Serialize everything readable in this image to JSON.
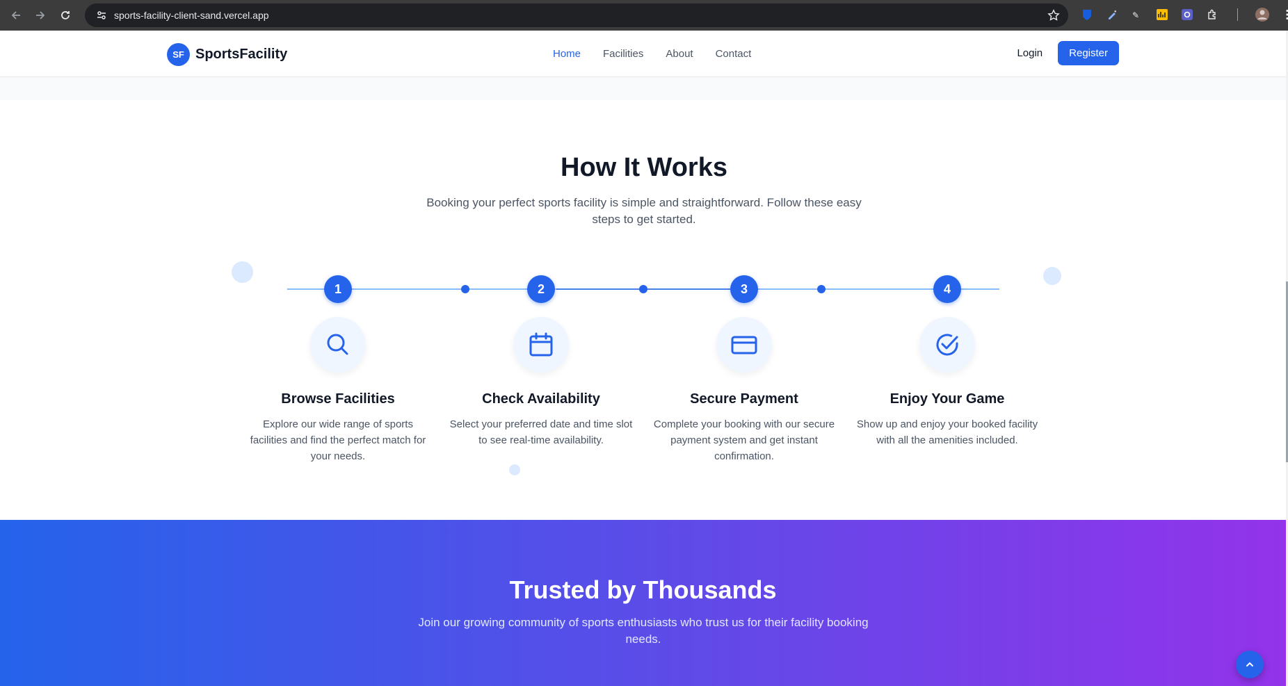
{
  "browser": {
    "url": "sports-facility-client-sand.vercel.app",
    "icons": [
      "back-icon",
      "forward-icon",
      "reload-icon",
      "site-info-icon",
      "bookmark-star-icon",
      "extensions-icon",
      "profile-icon",
      "menu-icon"
    ]
  },
  "header": {
    "logo_text": "SF",
    "brand": "SportsFacility",
    "nav": [
      "Home",
      "Facilities",
      "About",
      "Contact"
    ],
    "active_nav": "Home",
    "login": "Login",
    "register": "Register"
  },
  "how_it_works": {
    "title": "How It Works",
    "subtitle": "Booking your perfect sports facility is simple and straightforward. Follow these easy steps to get started.",
    "steps": [
      {
        "number": "1",
        "title": "Browse Facilities",
        "description": "Explore our wide range of sports facilities and find the perfect match for your needs.",
        "icon": "search-icon"
      },
      {
        "number": "2",
        "title": "Check Availability",
        "description": "Select your preferred date and time slot to see real-time availability.",
        "icon": "calendar-icon"
      },
      {
        "number": "3",
        "title": "Secure Payment",
        "description": "Complete your booking with our secure payment system and get instant confirmation.",
        "icon": "credit-card-icon"
      },
      {
        "number": "4",
        "title": "Enjoy Your Game",
        "description": "Show up and enjoy your booked facility with all the amenities included.",
        "icon": "check-circle-icon"
      }
    ]
  },
  "trusted": {
    "title": "Trusted by Thousands",
    "subtitle": "Join our growing community of sports enthusiasts who trust us for their facility booking needs."
  },
  "colors": {
    "accent": "#2563eb",
    "gradient_start": "#2563eb",
    "gradient_end": "#9333ea"
  }
}
